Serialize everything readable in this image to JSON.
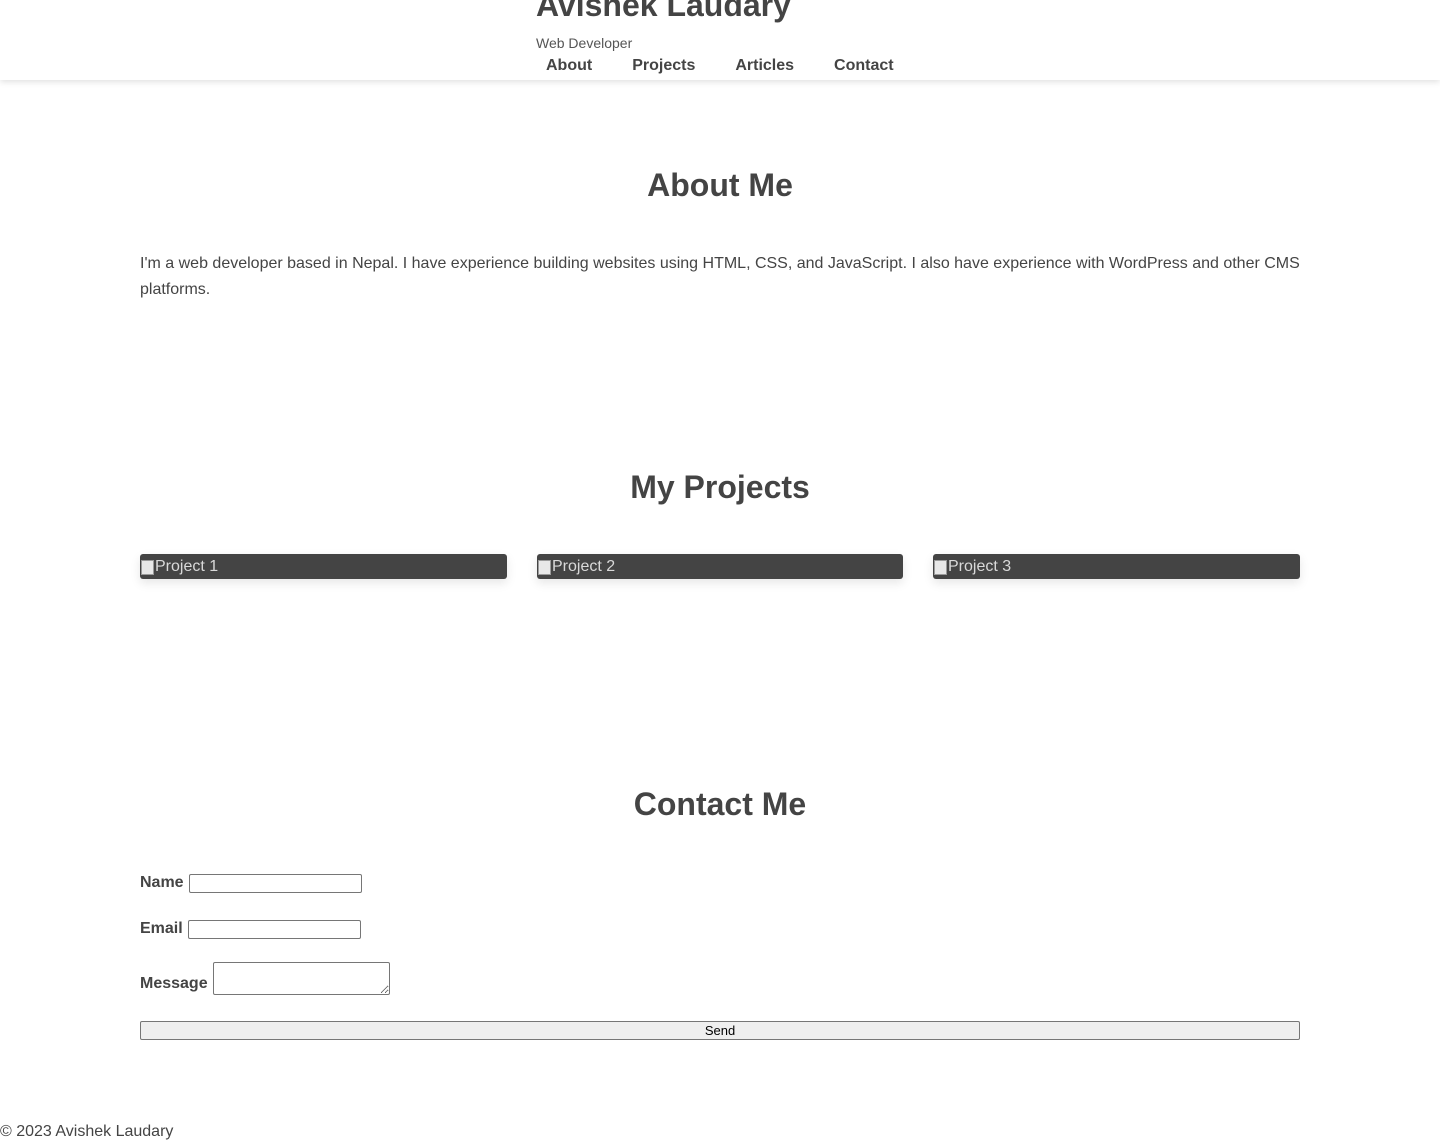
{
  "header": {
    "title": "Avishek Laudary",
    "subtitle": "Web Developer",
    "nav": [
      {
        "label": "About"
      },
      {
        "label": "Projects"
      },
      {
        "label": "Articles"
      },
      {
        "label": "Contact"
      }
    ]
  },
  "about": {
    "heading": "About Me",
    "text": "I'm a web developer based in Nepal. I have experience building websites using HTML, CSS, and JavaScript. I also have experience with WordPress and other CMS platforms."
  },
  "projects": {
    "heading": "My Projects",
    "items": [
      {
        "alt": "Project 1"
      },
      {
        "alt": "Project 2"
      },
      {
        "alt": "Project 3"
      }
    ],
    "card_color": "#444444"
  },
  "contact": {
    "heading": "Contact Me",
    "name_label": "Name",
    "name_value": "",
    "email_label": "Email",
    "email_value": "",
    "message_label": "Message",
    "message_value": "",
    "send_label": "Send"
  },
  "footer": {
    "text": "© 2023 Avishek Laudary"
  },
  "colors": {
    "text": "#444444",
    "background": "#ffffff"
  },
  "icons": [
    "broken-image-icon"
  ]
}
